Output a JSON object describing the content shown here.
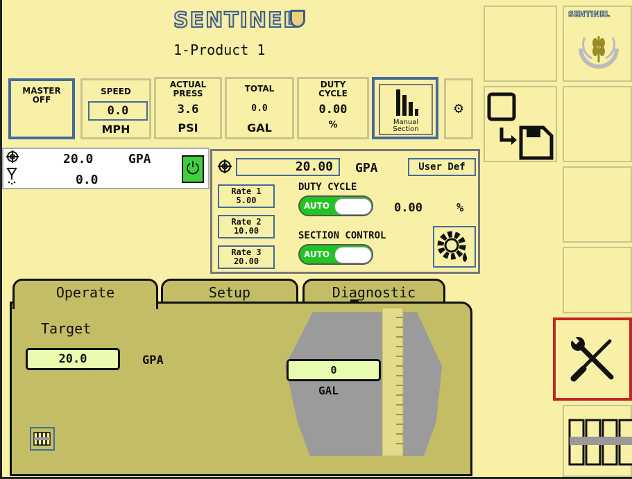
{
  "header": {
    "brand": "SENTINEL",
    "product": "1-Product 1"
  },
  "status": {
    "master": {
      "label": "MASTER\nOFF"
    },
    "speed": {
      "label": "SPEED",
      "value": "0.0",
      "unit": "MPH"
    },
    "press": {
      "label": "ACTUAL\nPRESS",
      "value": "3.6",
      "unit": "PSI"
    },
    "total": {
      "label": "TOTAL",
      "value": "0.0",
      "unit": "GAL"
    },
    "duty": {
      "label": "DUTY\nCYCLE",
      "value": "0.00",
      "unit": "%"
    },
    "manual": {
      "label": "Manual\nSection"
    }
  },
  "readout": {
    "rate": "20.0",
    "rate_unit": "GPA",
    "applied": "0.0"
  },
  "rate_panel": {
    "target": "20.00",
    "unit": "GPA",
    "user_def": "User Def",
    "rates": [
      {
        "label": "Rate 1",
        "value": "5.00"
      },
      {
        "label": "Rate 2",
        "value": "10.00"
      },
      {
        "label": "Rate 3",
        "value": "20.00"
      }
    ],
    "duty_cycle_label": "DUTY CYCLE",
    "duty_toggle": "AUTO",
    "duty_value": "0.00",
    "duty_unit": "%",
    "section_label": "SECTION CONTROL",
    "section_toggle": "AUTO"
  },
  "tabs": [
    {
      "label": "Operate",
      "active": true
    },
    {
      "label": "Setup",
      "active": false
    },
    {
      "label": "Diagnostic",
      "active": false
    }
  ],
  "operate": {
    "target_label": "Target",
    "target_value": "20.0",
    "target_unit": "GPA",
    "tank_value": "0",
    "tank_unit": "GAL"
  },
  "colors": {
    "background": "#f7f0a6",
    "panel": "#c3bd65",
    "accent_blue": "#466a9a",
    "toggle_green": "#22c422",
    "highlight_red": "#c22525"
  },
  "icons": [
    "target-icon",
    "nozzle-icon",
    "power-icon",
    "gear-icon",
    "save-icon",
    "wrench-screwdriver-icon",
    "sections-icon",
    "sentinel-wheat-logo"
  ]
}
